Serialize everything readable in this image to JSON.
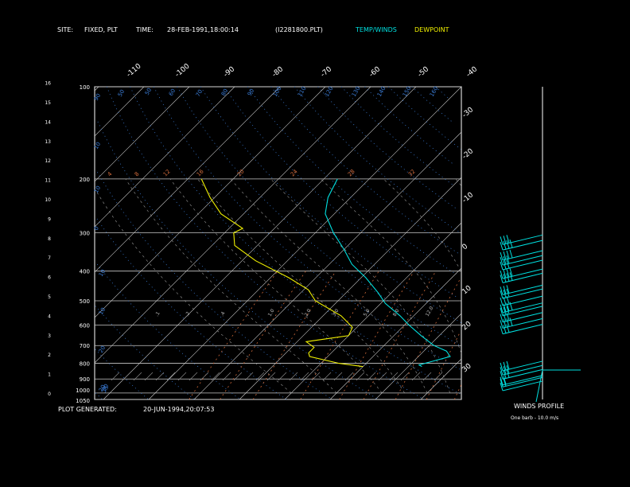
{
  "header": {
    "site_label": "SITE:",
    "site_value": "FIXED, PLT",
    "time_label": "TIME:",
    "time_value": "28-FEB-1991,18:00:14",
    "file": "(I2281800.PLT)",
    "temp_legend": "TEMP/WINDS",
    "dew_legend": "DEWPOINT"
  },
  "footer": {
    "generated_label": "PLOT GENERATED:",
    "generated_value": "20-JUN-1994,20:07:53",
    "winds_title": "WINDS PROFILE",
    "barb_note": "One barb - 10.0 m/s"
  },
  "colors": {
    "background": "#000000",
    "frame": "#ffffff",
    "isobar": "#c8c8c8",
    "isotherm": "#c8c8c8",
    "dry_adiabat": "#3a7bd5",
    "mixing_ratio": "#d06a3a",
    "moist_adiabat": "#9a9a9a",
    "temperature": "#00e0e0",
    "dewpoint": "#f0f000",
    "wind": "#00e0e0"
  },
  "chart_data": {
    "type": "skew-t",
    "pressure_ticks": [
      "100",
      "200",
      "300",
      "400",
      "500",
      "600",
      "700",
      "800",
      "900",
      "1000",
      "1050"
    ],
    "height_ticks_km": [
      "0",
      "1",
      "2",
      "3",
      "4",
      "5",
      "6",
      "7",
      "8",
      "9",
      "10",
      "11",
      "12",
      "13",
      "14",
      "15",
      "16"
    ],
    "temp_ticks_top": [
      "-110",
      "-100",
      "-90",
      "-80",
      "-70",
      "-60",
      "-50",
      "-40"
    ],
    "temp_ticks_right": [
      "-30",
      "-20",
      "-10",
      "0",
      "10",
      "20",
      "30"
    ],
    "dry_adiabat_labels": [
      "90",
      "50",
      "50",
      "60",
      "70",
      "80",
      "90",
      "100",
      "110",
      "120",
      "130",
      "140",
      "150",
      "160",
      "10",
      "10",
      "0",
      "10",
      "10",
      "20",
      "30",
      "20",
      "35"
    ],
    "moist_adiabat_labels": [
      "4",
      "8",
      "12",
      "16",
      "20",
      "24",
      "28",
      "32"
    ],
    "mixing_ratio_labels": [
      ".1",
      ".2",
      ".4",
      "1.0",
      "2.0",
      "3.0",
      "5.0",
      "8.0",
      "12.0"
    ],
    "temperature_profile": [
      {
        "p": 200,
        "t": -57
      },
      {
        "p": 230,
        "t": -55
      },
      {
        "p": 260,
        "t": -52
      },
      {
        "p": 300,
        "t": -46
      },
      {
        "p": 340,
        "t": -40
      },
      {
        "p": 380,
        "t": -35
      },
      {
        "p": 420,
        "t": -29
      },
      {
        "p": 470,
        "t": -23
      },
      {
        "p": 510,
        "t": -19
      },
      {
        "p": 560,
        "t": -13
      },
      {
        "p": 600,
        "t": -9
      },
      {
        "p": 650,
        "t": -4
      },
      {
        "p": 700,
        "t": 1
      },
      {
        "p": 730,
        "t": 5
      },
      {
        "p": 760,
        "t": 7
      },
      {
        "p": 790,
        "t": 4
      },
      {
        "p": 810,
        "t": 2
      },
      {
        "p": 820,
        "t": 3
      }
    ],
    "dewpoint_profile": [
      {
        "p": 200,
        "t": -87
      },
      {
        "p": 230,
        "t": -81
      },
      {
        "p": 260,
        "t": -75
      },
      {
        "p": 290,
        "t": -67
      },
      {
        "p": 300,
        "t": -68
      },
      {
        "p": 330,
        "t": -65
      },
      {
        "p": 370,
        "t": -57
      },
      {
        "p": 420,
        "t": -46
      },
      {
        "p": 460,
        "t": -39
      },
      {
        "p": 500,
        "t": -35
      },
      {
        "p": 560,
        "t": -26
      },
      {
        "p": 610,
        "t": -21
      },
      {
        "p": 650,
        "t": -20
      },
      {
        "p": 680,
        "t": -28
      },
      {
        "p": 710,
        "t": -25
      },
      {
        "p": 740,
        "t": -25
      },
      {
        "p": 760,
        "t": -24
      },
      {
        "p": 800,
        "t": -16
      },
      {
        "p": 820,
        "t": -10
      }
    ],
    "winds": [
      {
        "p": 240,
        "barbs": 3
      },
      {
        "p": 250,
        "barbs": 4
      },
      {
        "p": 270,
        "barbs": 4
      },
      {
        "p": 280,
        "barbs": 3
      },
      {
        "p": 290,
        "barbs": 3
      },
      {
        "p": 310,
        "barbs": 4
      },
      {
        "p": 320,
        "barbs": 4
      },
      {
        "p": 350,
        "barbs": 3
      },
      {
        "p": 360,
        "barbs": 3
      },
      {
        "p": 380,
        "barbs": 3
      },
      {
        "p": 400,
        "barbs": 4
      },
      {
        "p": 410,
        "barbs": 3
      },
      {
        "p": 430,
        "barbs": 3
      },
      {
        "p": 450,
        "barbs": 4
      },
      {
        "p": 470,
        "barbs": 3
      },
      {
        "p": 620,
        "barbs": 3
      },
      {
        "p": 640,
        "barbs": 3
      },
      {
        "p": 660,
        "barbs": 3
      },
      {
        "p": 690,
        "barbs": 2
      },
      {
        "p": 700,
        "barbs": 2
      },
      {
        "p": 720,
        "barbs": 1
      }
    ]
  }
}
